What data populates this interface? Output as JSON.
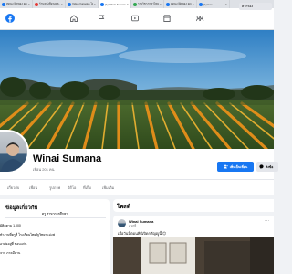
{
  "browser": {
    "tabs": [
      {
        "label": "ทดนะเปิดของ ฮ(no..."
      },
      {
        "label": "ร้านหนังสือรอยล..."
      },
      {
        "label": "Video Karaoke ไท..."
      },
      {
        "label": "(1) Winai Sumana"
      },
      {
        "label": "รายวิชาภาษาไทย..."
      },
      {
        "label": "ทดนะเปิดของ ฮ(no..."
      },
      {
        "label": "(1) Fac..."
      }
    ]
  },
  "colors": {
    "brand": "#1877f2",
    "page_bg": "#f0f2f5",
    "secondary_button": "#e4e6eb"
  },
  "profile": {
    "name": "Winai Sumana",
    "friends": "เพื่อน 201 คน",
    "add_friend": "เพิ่มเป็นเพื่อน",
    "message": "ส่งข้อ"
  },
  "profile_tabs": [
    "เกี่ยวกับ",
    "เพื่อน",
    "รูปภาพ",
    "วิดีโอ",
    "ที่เก็บ",
    "เพิ่มเติม"
  ],
  "intro": {
    "title": "ข้อมูลเกี่ยวกับ",
    "school": "ครู สาขาการศึกษา",
    "lines": [
      "ผู้ติดตาม 1,000",
      "ทำงานที่ครูที่ โรงเรียนไทยรัฐวิทยาแม่งฟ",
      "อาศัยอยู่ที่ ขอนแก่น",
      "จาก ภาคอีสาน"
    ]
  },
  "posts": {
    "title": "โพสต์",
    "filter": "ตัวกรอง"
  },
  "post": {
    "author": "Winai Sumana",
    "time": "2 นาที",
    "text": "เมื่อวันนี้ตอนพิธีเปิดกตัญญูนี้ 😊",
    "more": "···"
  }
}
